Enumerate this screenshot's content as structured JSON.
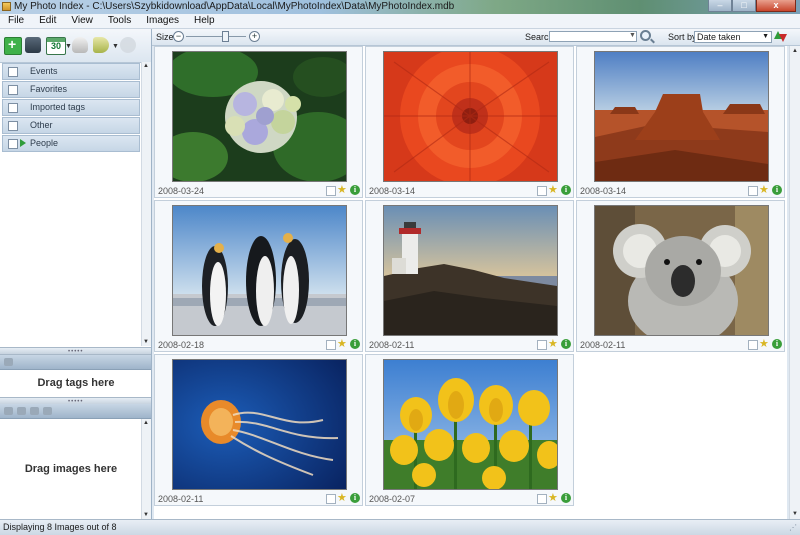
{
  "window": {
    "title": "My Photo Index - C:\\Users\\Szybkidownload\\AppData\\Local\\MyPhotoIndex\\Data\\MyPhotoIndex.mdb",
    "min": "–",
    "max": "□",
    "close": "x"
  },
  "menu": [
    "File",
    "Edit",
    "View",
    "Tools",
    "Images",
    "Help"
  ],
  "toolbar": {
    "calendar_day": "30",
    "icons": [
      "add-photos-icon",
      "import-camera-icon",
      "calendar-icon",
      "filter-icon",
      "tag-icon",
      "disabled-action-icon"
    ]
  },
  "categories": [
    {
      "label": "Events",
      "expandable": false
    },
    {
      "label": "Favorites",
      "expandable": false
    },
    {
      "label": "Imported tags",
      "expandable": false
    },
    {
      "label": "Other",
      "expandable": false
    },
    {
      "label": "People",
      "expandable": true
    }
  ],
  "panels": {
    "tags_drop": "Drag tags here",
    "images_drop": "Drag images here"
  },
  "topbar": {
    "size_label": "Size:",
    "zoom_out": "−",
    "zoom_in": "+",
    "zoom_level": 0.65,
    "search_label": "Search:",
    "search_value": "",
    "sort_label": "Sort by:",
    "sort_value": "Date taken"
  },
  "photos": [
    {
      "date": "2008-03-24",
      "subject": "hydrangea"
    },
    {
      "date": "2008-03-14",
      "subject": "chrysanthemum"
    },
    {
      "date": "2008-03-14",
      "subject": "desert"
    },
    {
      "date": "2008-02-18",
      "subject": "penguins"
    },
    {
      "date": "2008-02-11",
      "subject": "lighthouse"
    },
    {
      "date": "2008-02-11",
      "subject": "koala"
    },
    {
      "date": "2008-02-11",
      "subject": "jellyfish"
    },
    {
      "date": "2008-02-07",
      "subject": "tulips"
    }
  ],
  "status": "Displaying 8 Images out of 8",
  "colors": {
    "accent": "#3a9e3a",
    "star": "#d9b623",
    "panel": "#dfe8f1"
  }
}
